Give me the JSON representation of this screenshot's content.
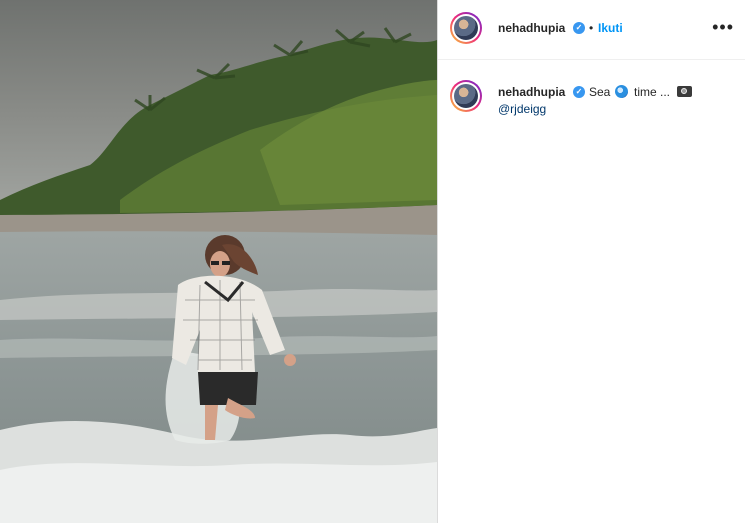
{
  "post": {
    "photo": {
      "subject": "beach-photo"
    },
    "header": {
      "username": "nehadhupia",
      "separator": "•",
      "follow_label": "Ikuti",
      "more_label": "•••"
    },
    "caption": {
      "username": "nehadhupia",
      "text_part1": "Sea",
      "text_part2": "time ...",
      "mention": "@rjdeigg"
    },
    "colors": {
      "link": "#0095f6",
      "verified": "#3897f0",
      "mention": "#00376b",
      "text": "#262626"
    }
  }
}
